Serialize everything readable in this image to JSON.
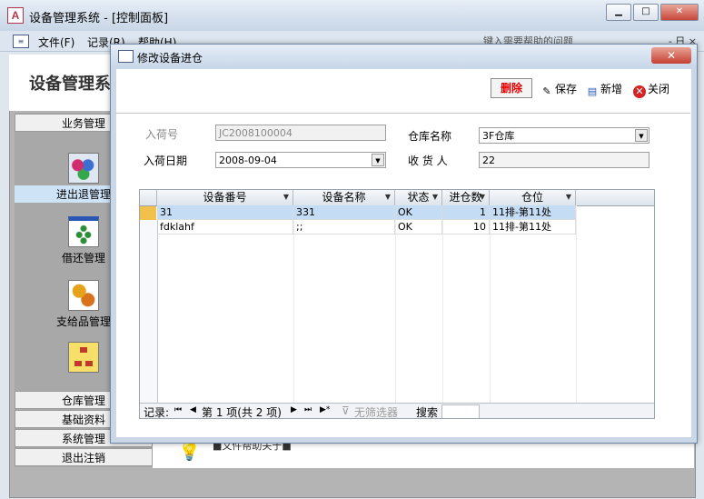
{
  "app": {
    "title": "设备管理系统 - [控制面板]",
    "app_icon": "A"
  },
  "window_controls": {
    "minimize": "▁",
    "restore": "□",
    "close": "✕"
  },
  "menubar": {
    "items": [
      "文件(F)",
      "记录(R)",
      "帮助(H)"
    ],
    "help_placeholder": "键入需要帮助的问题",
    "right_controls": "- 日 ×"
  },
  "panel": {
    "title": "设备管理系",
    "categories": [
      "业务管理",
      "仓库管理",
      "基础资料",
      "系统管理",
      "退出注销"
    ],
    "items": [
      {
        "label": "进出退管理",
        "icon": "cubes-icon",
        "selected": true
      },
      {
        "label": "借还管理",
        "icon": "dots-board-icon",
        "selected": false
      },
      {
        "label": "支给品管理",
        "icon": "gears-icon",
        "selected": false
      },
      {
        "label": "",
        "icon": "org-chart-icon",
        "selected": false
      }
    ],
    "status_text": "■文件帮助关于■"
  },
  "dialog": {
    "title": "修改设备进仓",
    "close_label": "✕",
    "toolbar": {
      "delete": "删除",
      "save": "保存",
      "new": "新增",
      "close": "关闭"
    },
    "form": {
      "receipt_no_label": "入荷号",
      "receipt_no_value": "JC2008100004",
      "warehouse_label": "仓库名称",
      "warehouse_value": "3F仓库",
      "receipt_date_label": "入荷日期",
      "receipt_date_value": "2008-09-04",
      "receiver_label": "收 货 人",
      "receiver_value": "22"
    },
    "table": {
      "columns": [
        "设备番号",
        "设备名称",
        "状态",
        "进仓数",
        "仓位"
      ],
      "rows": [
        {
          "device_no": "31",
          "device_name": "331",
          "status": "OK",
          "qty": "1",
          "location": "11排-第11处"
        },
        {
          "device_no": "fdklahf",
          "device_name": ";;",
          "status": "OK",
          "qty": "10",
          "location": "11排-第11处"
        }
      ]
    },
    "navigator": {
      "record_label": "记录:",
      "first": "⏮",
      "prev": "◀",
      "position": "第 1 项(共 2 项)",
      "next": "▶",
      "last": "⏭",
      "new_record": "▶*",
      "filter": "无筛选器",
      "search": "搜索"
    }
  },
  "colors": {
    "delete_text": "#e30000",
    "selected_row": "#c5dcf5",
    "title_gradient_top": "#e6eef8"
  }
}
